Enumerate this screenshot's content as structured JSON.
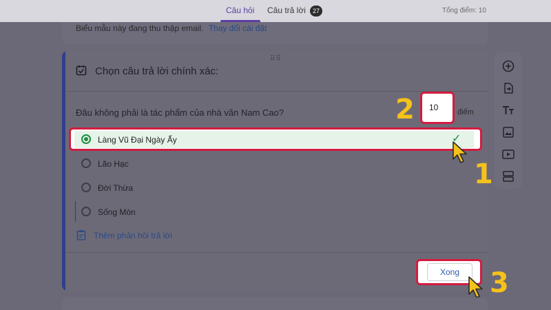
{
  "tabs": {
    "questions": "Câu hỏi",
    "responses": "Câu trả lời",
    "responses_count": "27",
    "total_points": "Tổng điểm: 10"
  },
  "email_notice": {
    "text": "Biểu mẫu này đang thu thập email.",
    "link": "Thay đổi cài đặt"
  },
  "answer_key": {
    "title": "Chọn câu trả lời chính xác:",
    "question": "Đâu không phải là tác phẩm của nhà văn Nam Cao?",
    "points_value": "10",
    "points_label": "điểm",
    "options": [
      {
        "label": "Làng Vũ Đại Ngày Ấy",
        "correct": true
      },
      {
        "label": "Lão Hạc",
        "correct": false
      },
      {
        "label": "Đời Thừa",
        "correct": false
      },
      {
        "label": "Sống Mòn",
        "correct": false
      }
    ],
    "feedback_link": "Thêm phản hồi trả lời",
    "done_button": "Xong"
  },
  "annotations": {
    "step1": "1",
    "step2": "2",
    "step3": "3"
  },
  "colors": {
    "accent": "#5b3fa3",
    "highlight": "#d31b3f",
    "step_number": "#f5c21b",
    "correct": "#1e8e3e"
  },
  "sidebar_tools": [
    "add-question-icon",
    "import-questions-icon",
    "add-title-icon",
    "add-image-icon",
    "add-video-icon",
    "add-section-icon"
  ]
}
